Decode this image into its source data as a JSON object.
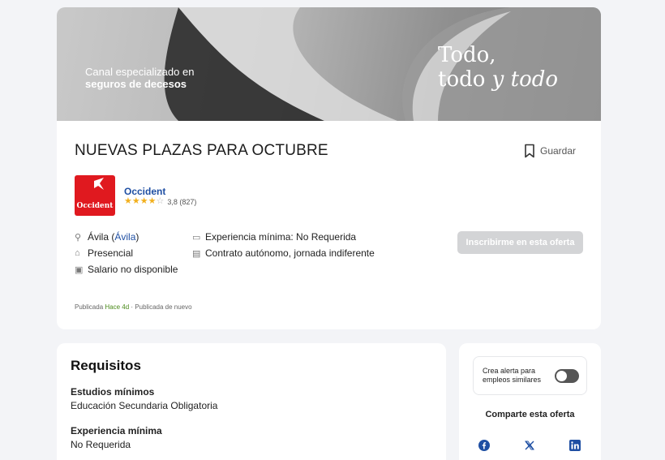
{
  "banner": {
    "left_line1": "Canal especializado en",
    "left_line2": "seguros de decesos",
    "right_line1": "Todo,",
    "right_line2_a": "todo ",
    "right_line2_b": "y",
    "right_line2_c": " todo"
  },
  "job": {
    "title": "NUEVAS PLAZAS PARA OCTUBRE",
    "save_label": "Guardar",
    "apply_label": "Inscribirme en esta oferta"
  },
  "company": {
    "logo_text": "Occident",
    "name": "Occident",
    "rating_value": "3,8 (827)",
    "stars_filled": 4,
    "stars_total": 5
  },
  "details": {
    "location_city": "Ávila",
    "location_link": "Ávila",
    "modality": "Presencial",
    "salary": "Salario no disponible",
    "experience": "Experiencia mínima: No Requerida",
    "contract": "Contrato autónomo, jornada indiferente"
  },
  "published": {
    "prefix": "Publicada",
    "ago": "Hace 4d",
    "suffix": "· Publicada de nuevo"
  },
  "requirements": {
    "title": "Requisitos",
    "items": [
      {
        "label": "Estudios mínimos",
        "value": "Educación Secundaria Obligatoria"
      },
      {
        "label": "Experiencia mínima",
        "value": "No Requerida"
      }
    ]
  },
  "sidebar": {
    "alert_line1": "Crea alerta para",
    "alert_line2": "empleos similares",
    "alert_enabled": false,
    "share_title": "Comparte esta oferta",
    "share_icons": [
      "facebook-icon",
      "x-icon",
      "linkedin-icon"
    ]
  },
  "colors": {
    "brand_red": "#e0191f",
    "link_blue": "#1f4fa3",
    "star_yellow": "#f2b01e",
    "ago_green": "#4a8a1a",
    "button_disabled": "#d3d4d6"
  }
}
